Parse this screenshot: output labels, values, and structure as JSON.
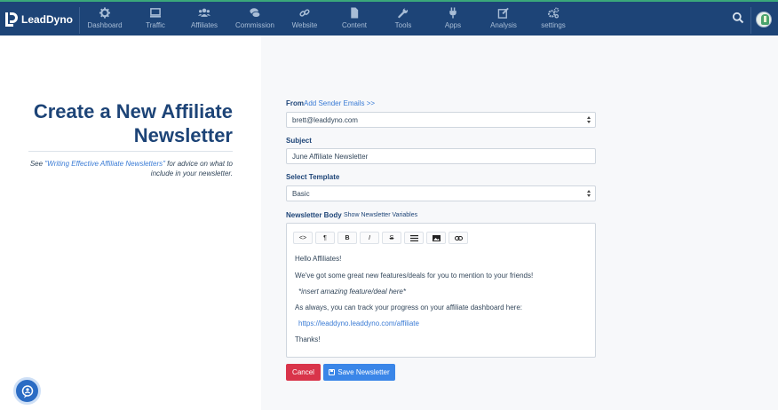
{
  "brand": {
    "name": "LeadDyno"
  },
  "nav": {
    "items": [
      {
        "label": "Dashboard",
        "icon": "dashboard-icon"
      },
      {
        "label": "Traffic",
        "icon": "monitor-icon"
      },
      {
        "label": "Affiliates",
        "icon": "users-icon"
      },
      {
        "label": "Commission",
        "icon": "money-icon"
      },
      {
        "label": "Website",
        "icon": "link-icon"
      },
      {
        "label": "Content",
        "icon": "file-icon"
      },
      {
        "label": "Tools",
        "icon": "wrench-icon"
      },
      {
        "label": "Apps",
        "icon": "plug-icon"
      },
      {
        "label": "Analysis",
        "icon": "edit-icon"
      },
      {
        "label": "settings",
        "icon": "cogs-icon"
      }
    ]
  },
  "page": {
    "title_line1": "Create a New Affiliate",
    "title_line2": "Newsletter",
    "advice_prefix": "See ",
    "advice_link": "\"Writing Effective Affiliate Newsletters\"",
    "advice_suffix1": " for advice on what to",
    "advice_suffix2": "include in your newsletter."
  },
  "form": {
    "from_label": "From",
    "add_sender_link": "Add Sender Emails >>",
    "from_value": "brett@leaddyno.com",
    "subject_label": "Subject",
    "subject_value": "June Affiliate Newsletter",
    "template_label": "Select Template",
    "template_value": "Basic",
    "body_label": "Newsletter Body",
    "show_vars_link": "Show Newsletter Variables",
    "toolbar": {
      "code": "<>",
      "paragraph": "¶",
      "bold": "B",
      "italic": "I",
      "strike": "S"
    },
    "body": {
      "line1": "Hello Affiliates!",
      "line2": "We've got some great new features/deals for you to mention to your friends!",
      "line3": "*insert amazing feature/deal here*",
      "line4": "As always, you can track your progress on your affiliate dashboard here:",
      "line5": "https://leaddyno.leaddyno.com/affiliate",
      "line6": "Thanks!"
    },
    "cancel_label": "Cancel",
    "save_label": "Save Newsletter"
  },
  "colors": {
    "nav_bg": "#1d4477",
    "title": "#1d4477",
    "link": "#3a7bd5",
    "cancel": "#d9344a",
    "save": "#3a86e8"
  }
}
